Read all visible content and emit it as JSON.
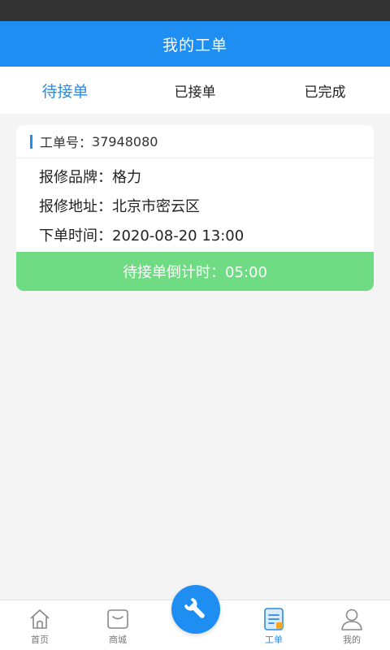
{
  "header": {
    "title": "我的工单"
  },
  "tabs": [
    {
      "label": "待接单",
      "active": true
    },
    {
      "label": "已接单",
      "active": false
    },
    {
      "label": "已完成",
      "active": false
    }
  ],
  "order": {
    "number_label": "工单号：",
    "number": "37948080",
    "brand": "报修品牌：格力",
    "address": "报修地址：北京市密云区",
    "time": "下单时间：2020-08-20  13:00",
    "countdown": "待接单倒计时：05:00"
  },
  "tabbar": {
    "items": [
      {
        "label": "首页",
        "icon": "home-icon"
      },
      {
        "label": "商城",
        "icon": "shop-icon"
      },
      {
        "label": "工单",
        "icon": "work-order-icon",
        "active": true
      },
      {
        "label": "我的",
        "icon": "profile-icon"
      }
    ],
    "center_icon": "wrench-icon"
  },
  "colors": {
    "primary": "#1f8ef2",
    "active_tab_text": "#2a8ce0",
    "countdown_bg": "#6fdc84",
    "status_bar": "#333333",
    "order_icon_accent": "#f5a623"
  }
}
